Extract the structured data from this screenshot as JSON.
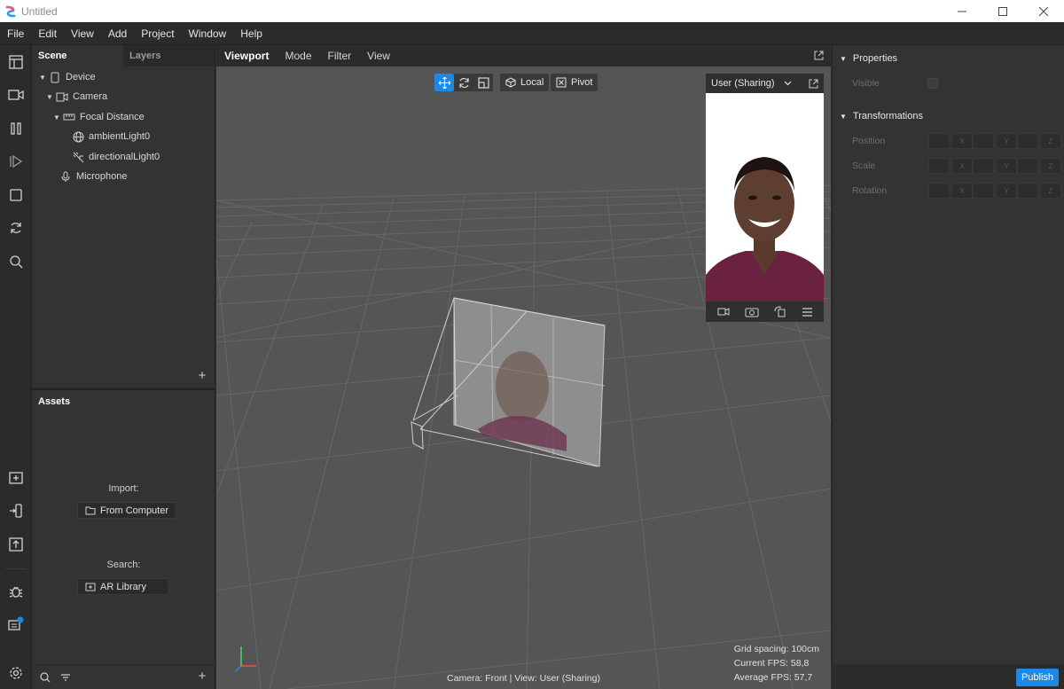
{
  "window": {
    "title": "Untitled"
  },
  "menu": [
    "File",
    "Edit",
    "View",
    "Add",
    "Project",
    "Window",
    "Help"
  ],
  "scene": {
    "tabs": [
      "Scene",
      "Layers"
    ],
    "items": [
      {
        "label": "Device",
        "icon": "phone-icon"
      },
      {
        "label": "Camera",
        "icon": "camera-icon"
      },
      {
        "label": "Focal Distance",
        "icon": "ruler-icon"
      },
      {
        "label": "ambientLight0",
        "icon": "globe-icon"
      },
      {
        "label": "directionalLight0",
        "icon": "directional-light-icon"
      },
      {
        "label": "Microphone",
        "icon": "microphone-icon"
      }
    ]
  },
  "assets": {
    "title": "Assets",
    "import_label": "Import:",
    "from_computer": "From Computer",
    "search_label": "Search:",
    "ar_library": "AR Library"
  },
  "viewport": {
    "tabs": [
      "Viewport",
      "Mode",
      "Filter",
      "View"
    ],
    "local_label": "Local",
    "pivot_label": "Pivot",
    "preview_label": "User (Sharing)",
    "status": "Camera: Front | View: User (Sharing)",
    "stats": [
      "Grid spacing: 100cm",
      "Current FPS:  58,8",
      "Average FPS:  57,7"
    ]
  },
  "properties": {
    "properties_label": "Properties",
    "visible_label": "Visible",
    "transformations_label": "Transformations",
    "rows": [
      "Position",
      "Scale",
      "Rotation"
    ],
    "axes": [
      "X",
      "Y",
      "Z"
    ]
  },
  "publish_label": "Publish",
  "colors": {
    "accent": "#1e88e5",
    "viewport_bg": "#555555",
    "panel_bg": "#333333"
  }
}
